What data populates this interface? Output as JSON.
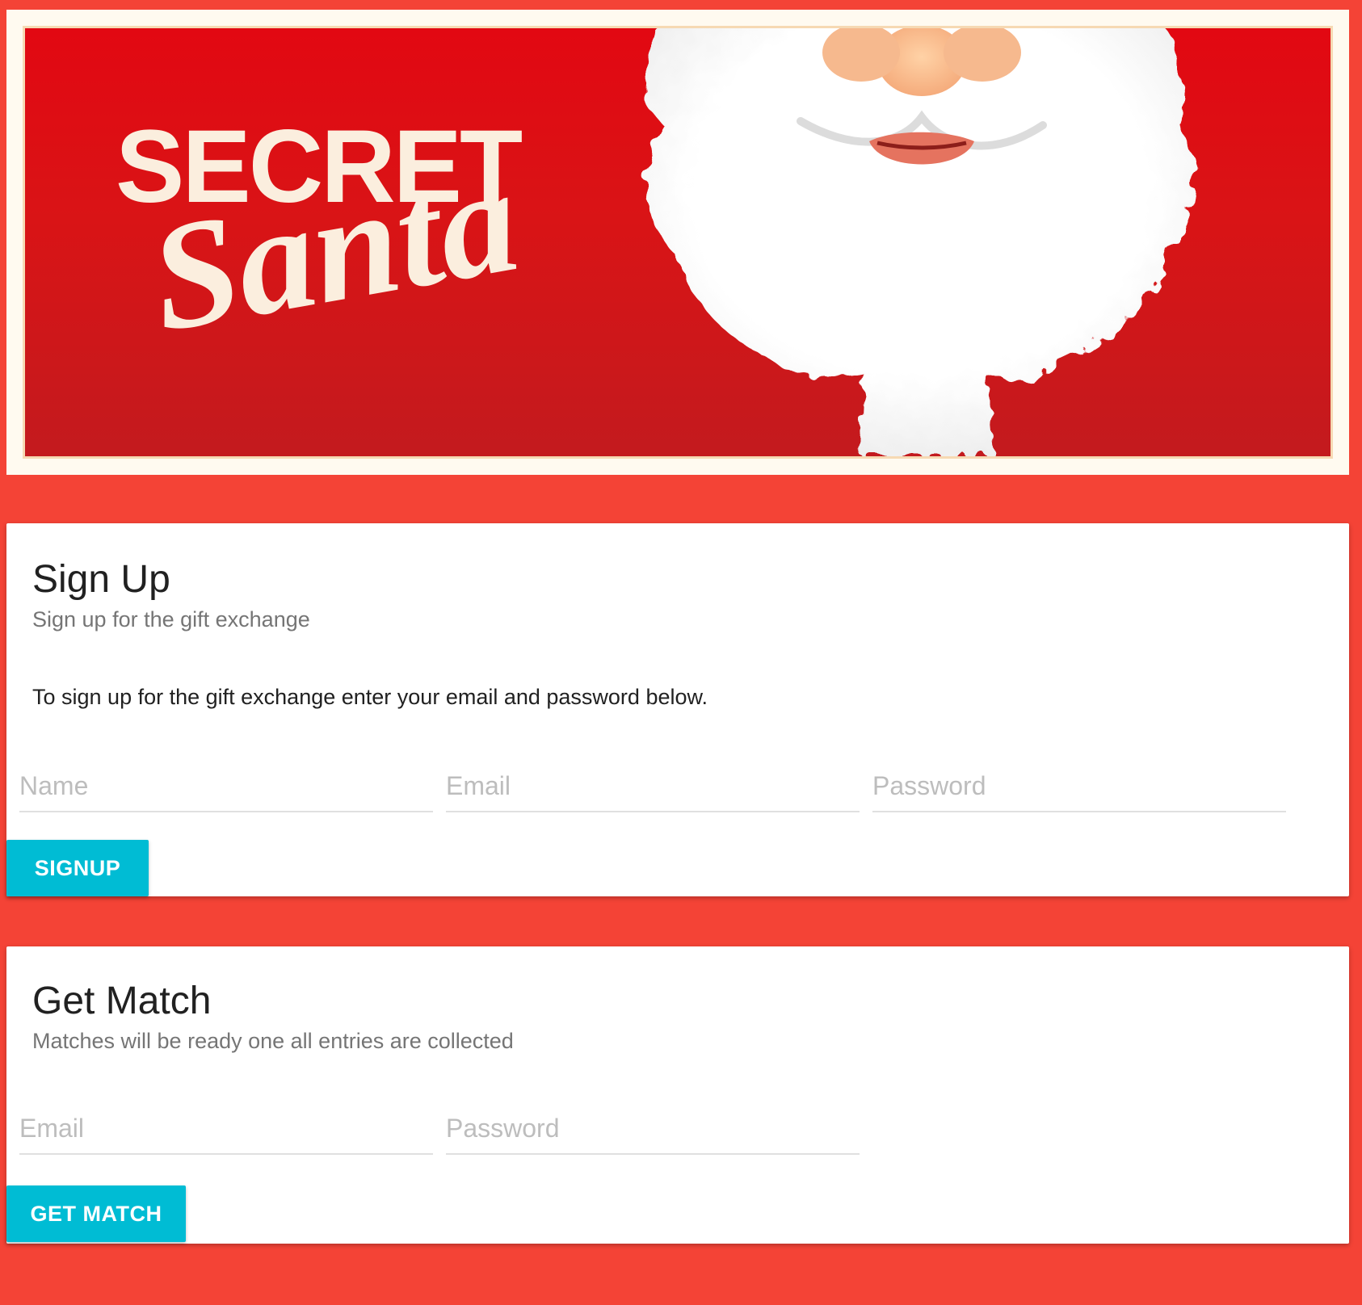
{
  "banner": {
    "title_line1": "SECRET",
    "title_line2": "Santa"
  },
  "signup": {
    "title": "Sign Up",
    "subtitle": "Sign up for the gift exchange",
    "text": "To sign up for the gift exchange enter your email and password below.",
    "fields": {
      "name_placeholder": "Name",
      "email_placeholder": "Email",
      "password_placeholder": "Password"
    },
    "button_label": "SIGNUP"
  },
  "match": {
    "title": "Get Match",
    "subtitle": "Matches will be ready one all entries are collected",
    "fields": {
      "email_placeholder": "Email",
      "password_placeholder": "Password"
    },
    "button_label": "GET MATCH"
  },
  "colors": {
    "page_background": "#f44336",
    "banner_red": "#d91416",
    "button_accent": "#00bcd4",
    "card_background": "#ffffff"
  }
}
